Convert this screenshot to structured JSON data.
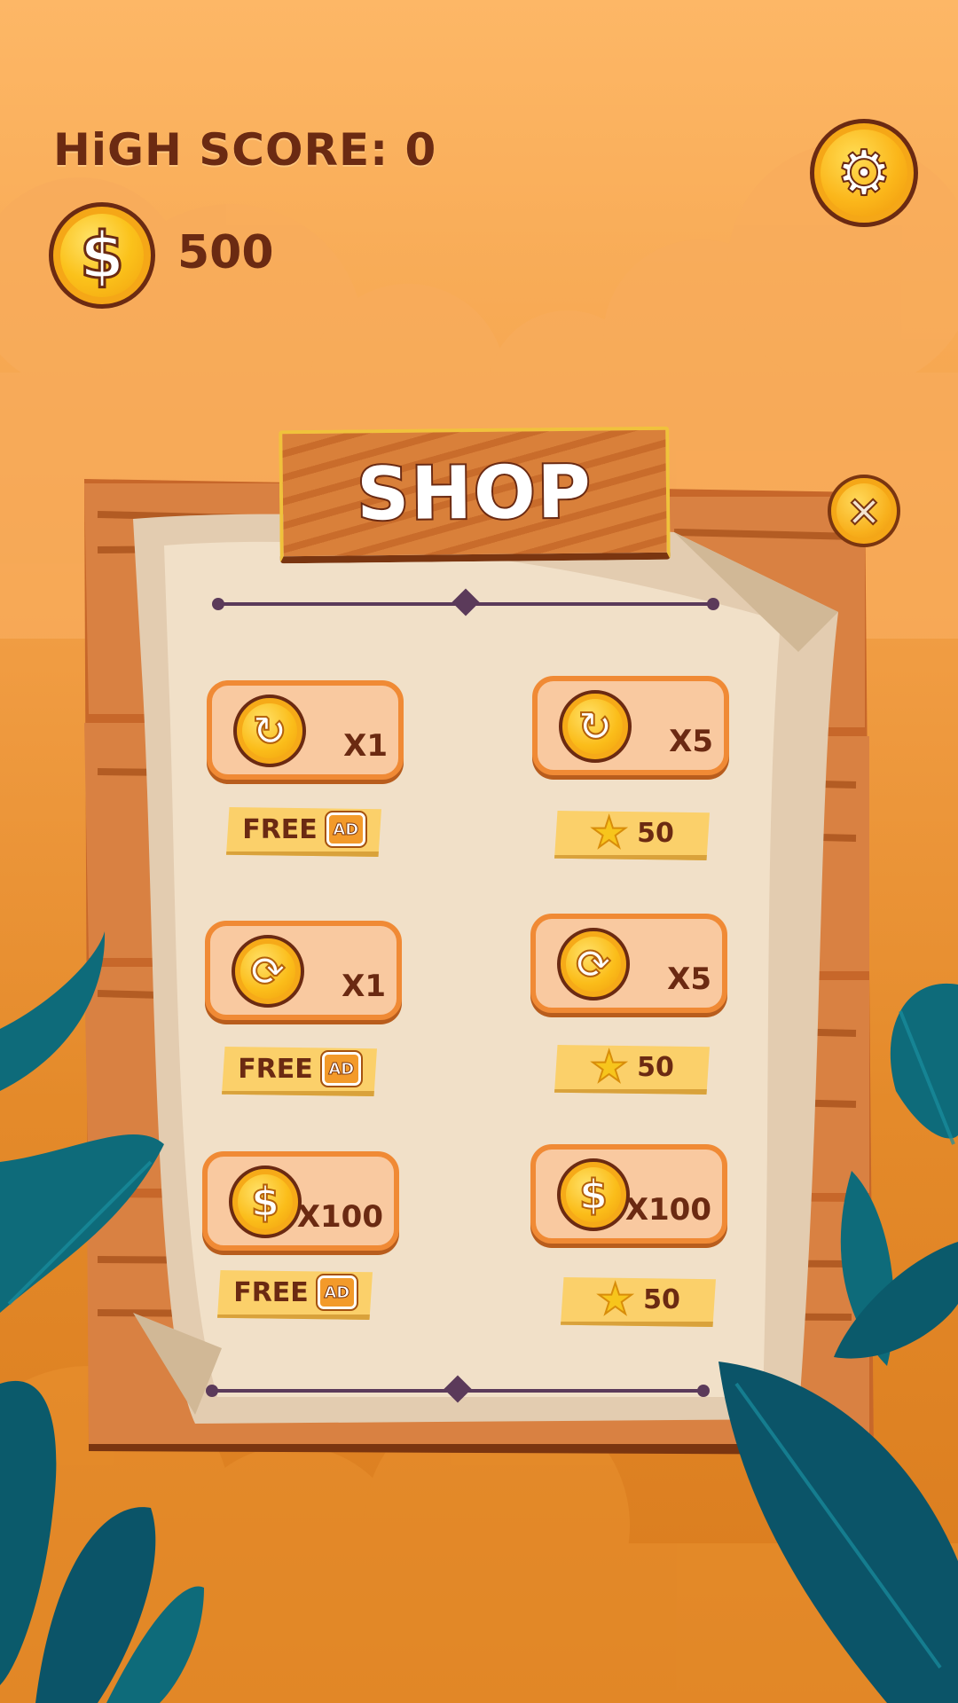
{
  "hud": {
    "high_score_label": "HiGH SCORE: 0",
    "coin_symbol": "$",
    "coins": "500",
    "settings_icon": "gear-icon"
  },
  "shop": {
    "title": "SHOP",
    "close_icon": "close-icon",
    "items": [
      {
        "icon": "undo-coin-icon",
        "glyph": "↻",
        "quantity": "X1",
        "price_type": "ad",
        "price_label": "FREE",
        "ad_label": "AD"
      },
      {
        "icon": "undo-coin-icon",
        "glyph": "↻",
        "quantity": "X5",
        "price_type": "stars",
        "price_label": "50"
      },
      {
        "icon": "shuffle-coin-icon",
        "glyph": "⟳",
        "quantity": "X1",
        "price_type": "ad",
        "price_label": "FREE",
        "ad_label": "AD"
      },
      {
        "icon": "shuffle-coin-icon",
        "glyph": "⟳",
        "quantity": "X5",
        "price_type": "stars",
        "price_label": "50"
      },
      {
        "icon": "dollar-coin-icon",
        "glyph": "$",
        "quantity": "X100",
        "price_type": "ad",
        "price_label": "FREE",
        "ad_label": "AD"
      },
      {
        "icon": "dollar-coin-icon",
        "glyph": "$",
        "quantity": "X100",
        "price_type": "stars",
        "price_label": "50"
      }
    ]
  },
  "colors": {
    "text_brown": "#6b2a12",
    "card_fill": "#f9c9a0",
    "card_border": "#f08a35",
    "tag_fill": "#fbd06a",
    "leaf_teal": "#0e6b7a"
  }
}
